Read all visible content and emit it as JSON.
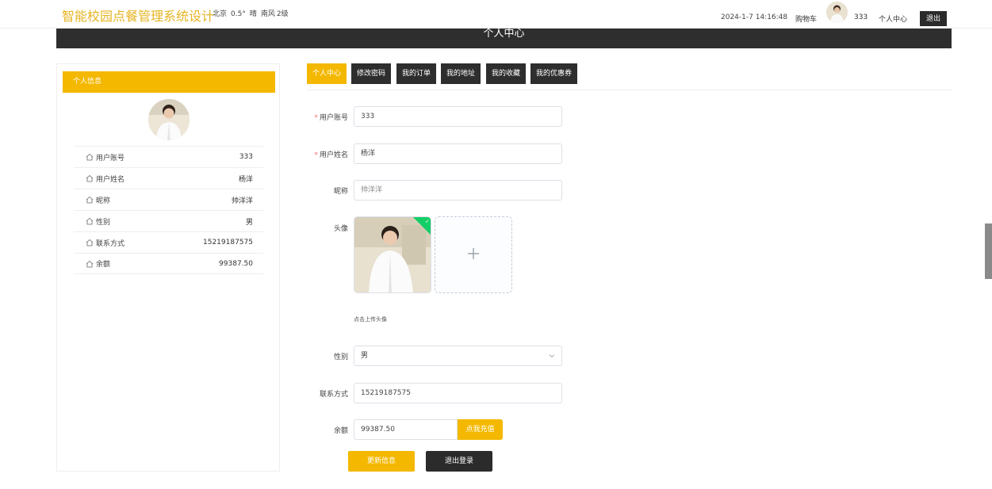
{
  "header": {
    "site_title": "智能校园点餐管理系统设计",
    "weather": {
      "city": "北京",
      "temp": "0.5°",
      "condition": "晴",
      "wind": "南风",
      "level": "2级"
    },
    "datetime": "2024-1-7 14:16:48",
    "cart_label": "购物车",
    "username": "333",
    "center_label": "个人中心",
    "logout_label": "退出"
  },
  "banner": {
    "title": "个人中心"
  },
  "sidebar": {
    "title": "个人信息",
    "rows": [
      {
        "label": "用户账号",
        "value": "333"
      },
      {
        "label": "用户姓名",
        "value": "杨洋"
      },
      {
        "label": "昵称",
        "value": "帅洋洋"
      },
      {
        "label": "性别",
        "value": "男"
      },
      {
        "label": "联系方式",
        "value": "15219187575"
      },
      {
        "label": "余额",
        "value": "99387.50"
      }
    ]
  },
  "tabs": [
    {
      "label": "个人中心",
      "active": true
    },
    {
      "label": "修改密码"
    },
    {
      "label": "我的订单"
    },
    {
      "label": "我的地址"
    },
    {
      "label": "我的收藏"
    },
    {
      "label": "我的优惠券"
    }
  ],
  "form": {
    "account": {
      "label": "用户账号",
      "value": "333",
      "required": "*"
    },
    "name": {
      "label": "用户姓名",
      "value": "杨洋",
      "required": "*"
    },
    "nickname": {
      "label": "昵称",
      "value": "帅洋洋"
    },
    "avatar": {
      "label": "头像",
      "hint": "点击上传头像"
    },
    "gender": {
      "label": "性别",
      "value": "男"
    },
    "phone": {
      "label": "联系方式",
      "value": "15219187575"
    },
    "balance": {
      "label": "余额",
      "value": "99387.50",
      "recharge_label": "点我充值"
    },
    "update_label": "更新信息",
    "logout_label": "退出登录"
  },
  "colors": {
    "accent": "#f4b800",
    "dark": "#2e2e2e",
    "title": "#e6b422"
  }
}
